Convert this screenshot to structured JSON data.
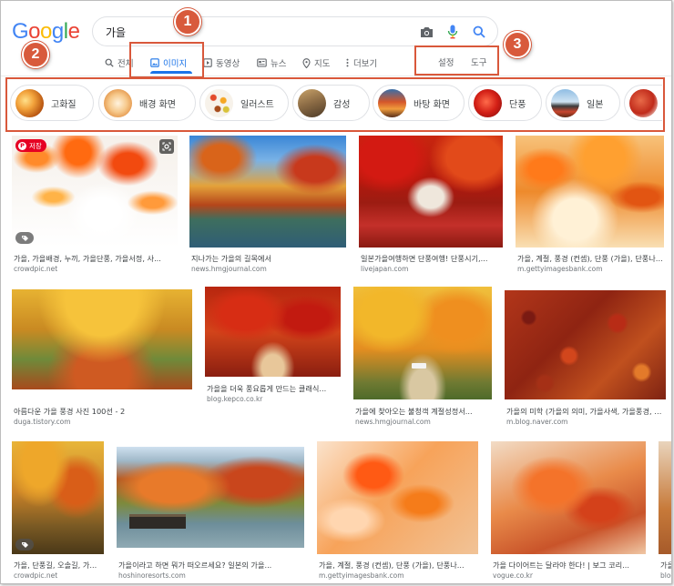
{
  "logo": {
    "letters": [
      "G",
      "o",
      "o",
      "g",
      "l",
      "e"
    ],
    "colors": [
      "#4285F4",
      "#EA4335",
      "#FBBC05",
      "#4285F4",
      "#34A853",
      "#EA4335"
    ]
  },
  "search": {
    "query": "가을",
    "icons": [
      "camera-icon",
      "microphone-icon",
      "search-icon"
    ]
  },
  "tabs": [
    {
      "label": "전체",
      "icon": "search-icon"
    },
    {
      "label": "이미지",
      "icon": "image-icon",
      "active": true
    },
    {
      "label": "동영상",
      "icon": "play-icon"
    },
    {
      "label": "뉴스",
      "icon": "news-icon"
    },
    {
      "label": "지도",
      "icon": "map-pin-icon"
    },
    {
      "label": "더보기",
      "icon": "more-vert-icon"
    }
  ],
  "right_links": {
    "settings": "설정",
    "tools": "도구"
  },
  "chips": [
    {
      "label": "고화질"
    },
    {
      "label": "배경 화면"
    },
    {
      "label": "일러스트"
    },
    {
      "label": "감성"
    },
    {
      "label": "바탕 화면"
    },
    {
      "label": "단풍"
    },
    {
      "label": "일본"
    },
    {
      "label": ""
    }
  ],
  "results": [
    {
      "title": "가을, 가을배경, 누끼, 가을단풍, 가을서정, 사...",
      "source": "crowdpic.net",
      "badges": [
        "pinterest-save",
        "lens",
        "tag"
      ],
      "save_label": "저장"
    },
    {
      "title": "지나가는 가을의 길목에서",
      "source": "news.hmgjournal.com"
    },
    {
      "title": "일본가을여행하면 단풍여행! 단풍시기,...",
      "source": "livejapan.com"
    },
    {
      "title": "가을, 계절, 풍경 (컨셉), 단풍 (가을), 단풍나무...",
      "source": "m.gettyimagesbank.com"
    },
    {
      "title": "아름다운 가을 풍경 사진 100선 - 2",
      "source": "duga.tistory.com"
    },
    {
      "title": "가을을 더욱 풍요롭게 만드는 클래식...",
      "source": "blog.kepco.co.kr"
    },
    {
      "title": "가을에 찾아오는 불청객 계절성정서...",
      "source": "news.hmgjournal.com"
    },
    {
      "title": "가을의 미학 (가을의 의미, 가을사색, 가을풍경, 가...",
      "source": "m.blog.naver.com"
    },
    {
      "title": "가을, 단풍길, 오솔길, 가...",
      "source": "crowdpic.net",
      "badges": [
        "tag"
      ]
    },
    {
      "title": "가을이라고 하면 뭐가 떠오르세요? 일본의 가을...",
      "source": "hoshinoresorts.com"
    },
    {
      "title": "가을, 계절, 풍경 (컨셉), 단풍 (가을), 단풍나...",
      "source": "m.gettyimagesbank.com"
    },
    {
      "title": "가을 다이어트는 달라야 한다! | 보그 코리...",
      "source": "vogue.co.kr"
    },
    {
      "title": "가을...",
      "source": "blog...."
    }
  ],
  "callouts": [
    "1",
    "2",
    "3"
  ]
}
